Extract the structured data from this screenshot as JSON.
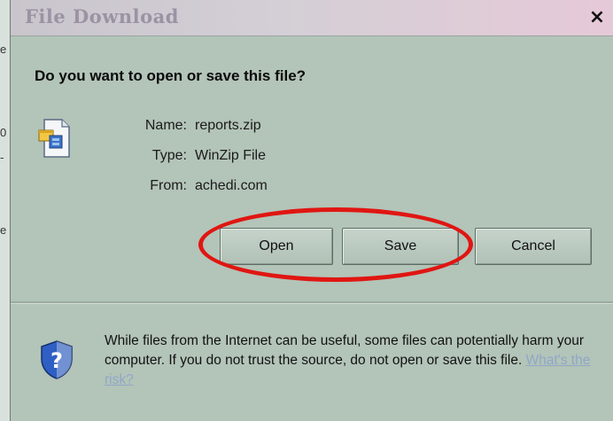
{
  "window": {
    "title": "File Download",
    "close_symbol": "×"
  },
  "prompt": {
    "question": "Do you want to open or save this file?"
  },
  "file": {
    "icon": "zip-file-icon",
    "rows": [
      {
        "label": "Name:",
        "value": "reports.zip"
      },
      {
        "label": "Type:",
        "value": "WinZip File"
      },
      {
        "label": "From:",
        "value": "achedi.com"
      }
    ]
  },
  "buttons": {
    "open": "Open",
    "save": "Save",
    "cancel": "Cancel"
  },
  "annotation": {
    "color": "#e01612"
  },
  "warning": {
    "icon": "shield-question-icon",
    "text": "While files from the Internet can be useful, some files can potentially harm your computer. If you do not trust the source, do not open or save this file. ",
    "link": "What's the risk?"
  },
  "background_edge": {
    "fragments": [
      "e",
      "0",
      "-",
      "e"
    ]
  }
}
